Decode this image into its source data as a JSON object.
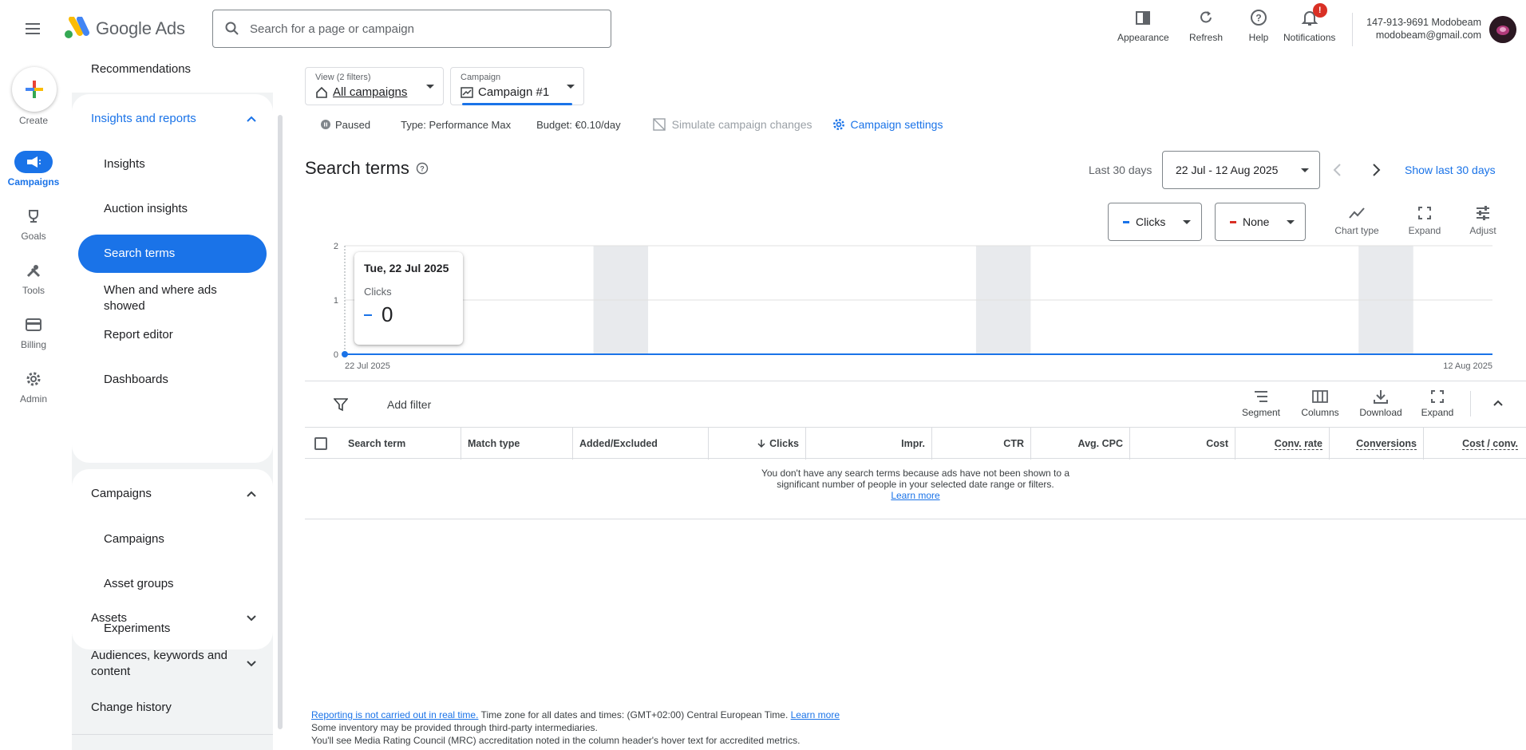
{
  "app": {
    "logo_text": "Google Ads"
  },
  "search": {
    "placeholder": "Search for a page or campaign"
  },
  "top_tools": [
    {
      "label": "Appearance",
      "icon": "appearance-icon"
    },
    {
      "label": "Refresh",
      "icon": "refresh-icon"
    },
    {
      "label": "Help",
      "icon": "help-icon"
    },
    {
      "label": "Notifications",
      "icon": "bell-icon",
      "badge": "!"
    }
  ],
  "account": {
    "id_name": "147-913-9691 Modobeam",
    "email": "modobeam@gmail.com"
  },
  "rail": {
    "create": "Create",
    "items": [
      {
        "label": "Campaigns",
        "icon": "megaphone-icon",
        "active": true
      },
      {
        "label": "Goals",
        "icon": "trophy-icon"
      },
      {
        "label": "Tools",
        "icon": "tools-icon"
      },
      {
        "label": "Billing",
        "icon": "card-icon"
      },
      {
        "label": "Admin",
        "icon": "gear-icon"
      }
    ]
  },
  "sidenav": {
    "recommendations": "Recommendations",
    "insights_group": {
      "title": "Insights and reports",
      "items": [
        "Insights",
        "Auction insights",
        "Search terms",
        "When and where ads showed",
        "Report editor",
        "Dashboards"
      ],
      "active": "Search terms"
    },
    "campaigns_group": {
      "title": "Campaigns",
      "items": [
        "Campaigns",
        "Asset groups",
        "Experiments"
      ]
    },
    "assets": "Assets",
    "audiences": "Audiences, keywords and content",
    "change_history": "Change history"
  },
  "view_selector": {
    "caption": "View (2 filters)",
    "value": "All campaigns"
  },
  "campaign_selector": {
    "caption": "Campaign",
    "value": "Campaign #1"
  },
  "status": {
    "state": "Paused",
    "type": "Type: Performance Max",
    "budget": "Budget: €0.10/day",
    "simulate": "Simulate campaign changes",
    "settings": "Campaign settings"
  },
  "page": {
    "title": "Search terms",
    "date_label": "Last 30 days",
    "date_range": "22 Jul - 12 Aug 2025",
    "show_last": "Show last 30 days"
  },
  "chart_controls": {
    "metric1": "Clicks",
    "metric1_color": "#1a73e8",
    "metric2": "None",
    "metric2_color": "#d93025",
    "tools": [
      "Chart type",
      "Expand",
      "Adjust"
    ]
  },
  "chart_data": {
    "type": "line",
    "series": [
      {
        "name": "Clicks",
        "color": "#1a73e8",
        "values": [
          0,
          0
        ]
      }
    ],
    "x": [
      "22 Jul 2025",
      "12 Aug 2025"
    ],
    "x_tick_labels": [
      "22 Jul 2025",
      "12 Aug 2025"
    ],
    "y_ticks": [
      0,
      1,
      2
    ],
    "ylim": [
      0,
      2
    ],
    "grid": true,
    "tooltip": {
      "date": "Tue, 22 Jul 2025",
      "metric": "Clicks",
      "value": "0"
    }
  },
  "table": {
    "add_filter": "Add filter",
    "tools": [
      "Segment",
      "Columns",
      "Download",
      "Expand"
    ],
    "columns": [
      "Search term",
      "Match type",
      "Added/Excluded",
      "Clicks",
      "Impr.",
      "CTR",
      "Avg. CPC",
      "Cost",
      "Conv. rate",
      "Conversions",
      "Cost / conv."
    ],
    "empty_line1": "You don't have any search terms because ads have not been shown to a",
    "empty_line2": "significant number of people in your selected date range or filters.",
    "learn_more": "Learn more"
  },
  "footer": {
    "realtime_link": "Reporting is not carried out in real time.",
    "timezone": " Time zone for all dates and times: (GMT+02:00) Central European Time. ",
    "learn_more": "Learn more",
    "line2": "Some inventory may be provided through third-party intermediaries.",
    "line3": "You'll see Media Rating Council (MRC) accreditation noted in the column header's hover text for accredited metrics."
  }
}
